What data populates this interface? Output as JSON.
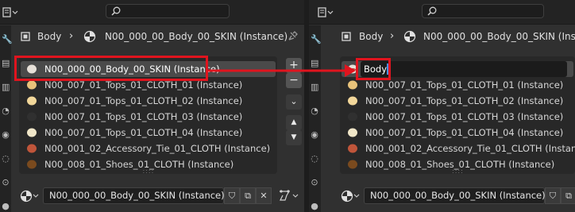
{
  "left_panel": {
    "breadcrumb": {
      "object": "Body",
      "material": "N00_000_00_Body_00_SKIN (Instance)"
    },
    "material_slots": [
      {
        "label": "N00_000_00_Body_00_SKIN (Instance)",
        "swatch": "#e6e0d8",
        "active": true
      },
      {
        "label": "N00_007_01_Tops_01_CLOTH_01 (Instance)",
        "swatch": "#e8c27a",
        "active": false
      },
      {
        "label": "N00_007_01_Tops_01_CLOTH_02 (Instance)",
        "swatch": "#f2d79a",
        "active": false
      },
      {
        "label": "N00_007_01_Tops_01_CLOTH_03 (Instance)",
        "swatch": "#303030",
        "active": false
      },
      {
        "label": "N00_007_01_Tops_01_CLOTH_04 (Instance)",
        "swatch": "#f0e6c8",
        "active": false
      },
      {
        "label": "N00_001_02_Accessory_Tie_01_CLOTH (Instance)",
        "swatch": "#c0553a",
        "active": false
      },
      {
        "label": "N00_008_01_Shoes_01_CLOTH (Instance)",
        "swatch": "#7a4a1e",
        "active": false
      }
    ],
    "material_field": "N00_000_00_Body_00_SKIN (Instance)"
  },
  "right_panel": {
    "breadcrumb": {
      "object": "Body",
      "material": "N00_000_00_Body_00_SKIN (Instance)"
    },
    "editing_value": "Body",
    "material_slots": [
      {
        "label": "N00_007_01_Tops_01_CLOTH_01 (Instance)",
        "swatch": "#e8c27a"
      },
      {
        "label": "N00_007_01_Tops_01_CLOTH_02 (Instance)",
        "swatch": "#f2d79a"
      },
      {
        "label": "N00_007_01_Tops_01_CLOTH_03 (Instance)",
        "swatch": "#303030"
      },
      {
        "label": "N00_007_01_Tops_01_CLOTH_04 (Instance)",
        "swatch": "#f0e6c8"
      },
      {
        "label": "N00_001_02_Accessory_Tie_01_CLOTH (Instance)",
        "swatch": "#c0553a"
      },
      {
        "label": "N00_008_01_Shoes_01_CLOTH (Instance)",
        "swatch": "#7a4a1e"
      }
    ],
    "material_field": "N00_000_00_Body_00_SKIN (Instance)"
  },
  "colors": {
    "annotation": "#e0141e",
    "caret": "#4a90ff"
  }
}
